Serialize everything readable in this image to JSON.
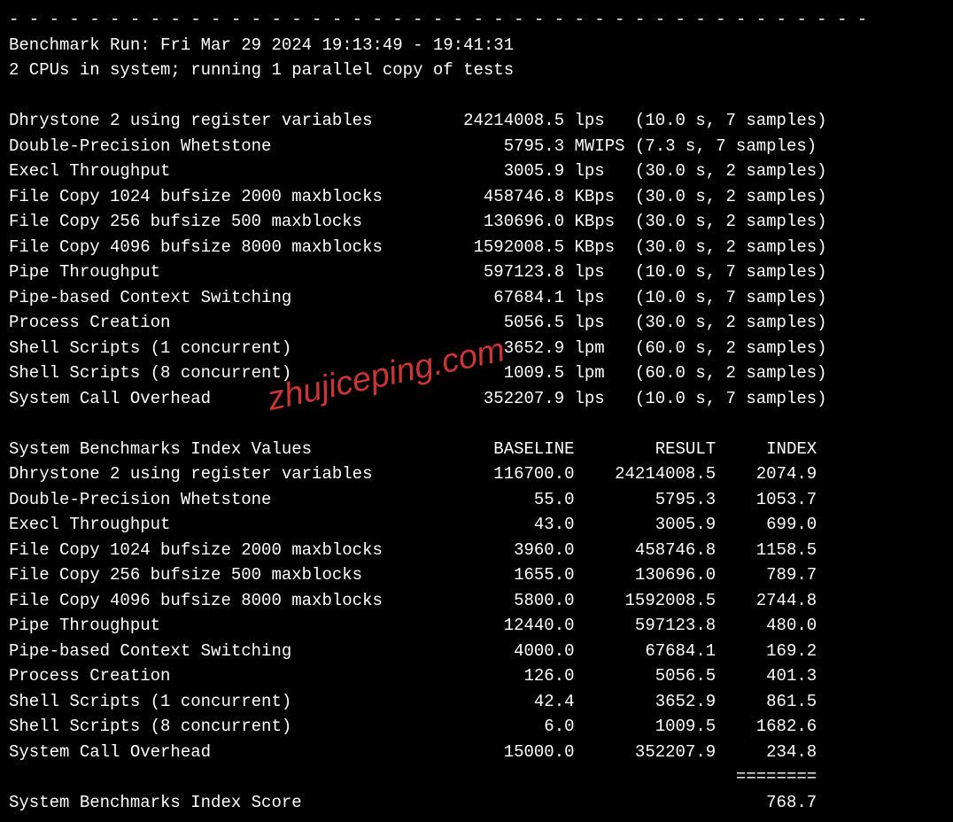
{
  "divider": "- - - - - - - - - - - - - - - - - - - - - - - - - - - - - - - - - - - - - - - - - - -",
  "header": {
    "run_line": "Benchmark Run: Fri Mar 29 2024 19:13:49 - 19:41:31",
    "cpu_line": "2 CPUs in system; running 1 parallel copy of tests"
  },
  "results_section": {
    "rows": [
      {
        "name": "Dhrystone 2 using register variables",
        "value": "24214008.5",
        "unit": "lps",
        "timing": "(10.0 s, 7 samples)"
      },
      {
        "name": "Double-Precision Whetstone",
        "value": "5795.3",
        "unit": "MWIPS",
        "timing": "(7.3 s, 7 samples)"
      },
      {
        "name": "Execl Throughput",
        "value": "3005.9",
        "unit": "lps",
        "timing": "(30.0 s, 2 samples)"
      },
      {
        "name": "File Copy 1024 bufsize 2000 maxblocks",
        "value": "458746.8",
        "unit": "KBps",
        "timing": "(30.0 s, 2 samples)"
      },
      {
        "name": "File Copy 256 bufsize 500 maxblocks",
        "value": "130696.0",
        "unit": "KBps",
        "timing": "(30.0 s, 2 samples)"
      },
      {
        "name": "File Copy 4096 bufsize 8000 maxblocks",
        "value": "1592008.5",
        "unit": "KBps",
        "timing": "(30.0 s, 2 samples)"
      },
      {
        "name": "Pipe Throughput",
        "value": "597123.8",
        "unit": "lps",
        "timing": "(10.0 s, 7 samples)"
      },
      {
        "name": "Pipe-based Context Switching",
        "value": "67684.1",
        "unit": "lps",
        "timing": "(10.0 s, 7 samples)"
      },
      {
        "name": "Process Creation",
        "value": "5056.5",
        "unit": "lps",
        "timing": "(30.0 s, 2 samples)"
      },
      {
        "name": "Shell Scripts (1 concurrent)",
        "value": "3652.9",
        "unit": "lpm",
        "timing": "(60.0 s, 2 samples)"
      },
      {
        "name": "Shell Scripts (8 concurrent)",
        "value": "1009.5",
        "unit": "lpm",
        "timing": "(60.0 s, 2 samples)"
      },
      {
        "name": "System Call Overhead",
        "value": "352207.9",
        "unit": "lps",
        "timing": "(10.0 s, 7 samples)"
      }
    ]
  },
  "index_section": {
    "header": {
      "title": "System Benchmarks Index Values",
      "col_baseline": "BASELINE",
      "col_result": "RESULT",
      "col_index": "INDEX"
    },
    "rows": [
      {
        "name": "Dhrystone 2 using register variables",
        "baseline": "116700.0",
        "result": "24214008.5",
        "index": "2074.9"
      },
      {
        "name": "Double-Precision Whetstone",
        "baseline": "55.0",
        "result": "5795.3",
        "index": "1053.7"
      },
      {
        "name": "Execl Throughput",
        "baseline": "43.0",
        "result": "3005.9",
        "index": "699.0"
      },
      {
        "name": "File Copy 1024 bufsize 2000 maxblocks",
        "baseline": "3960.0",
        "result": "458746.8",
        "index": "1158.5"
      },
      {
        "name": "File Copy 256 bufsize 500 maxblocks",
        "baseline": "1655.0",
        "result": "130696.0",
        "index": "789.7"
      },
      {
        "name": "File Copy 4096 bufsize 8000 maxblocks",
        "baseline": "5800.0",
        "result": "1592008.5",
        "index": "2744.8"
      },
      {
        "name": "Pipe Throughput",
        "baseline": "12440.0",
        "result": "597123.8",
        "index": "480.0"
      },
      {
        "name": "Pipe-based Context Switching",
        "baseline": "4000.0",
        "result": "67684.1",
        "index": "169.2"
      },
      {
        "name": "Process Creation",
        "baseline": "126.0",
        "result": "5056.5",
        "index": "401.3"
      },
      {
        "name": "Shell Scripts (1 concurrent)",
        "baseline": "42.4",
        "result": "3652.9",
        "index": "861.5"
      },
      {
        "name": "Shell Scripts (8 concurrent)",
        "baseline": "6.0",
        "result": "1009.5",
        "index": "1682.6"
      },
      {
        "name": "System Call Overhead",
        "baseline": "15000.0",
        "result": "352207.9",
        "index": "234.8"
      }
    ],
    "score_divider": "========",
    "score_label": "System Benchmarks Index Score",
    "score_value": "768.7"
  },
  "watermark": "zhujiceping.com"
}
